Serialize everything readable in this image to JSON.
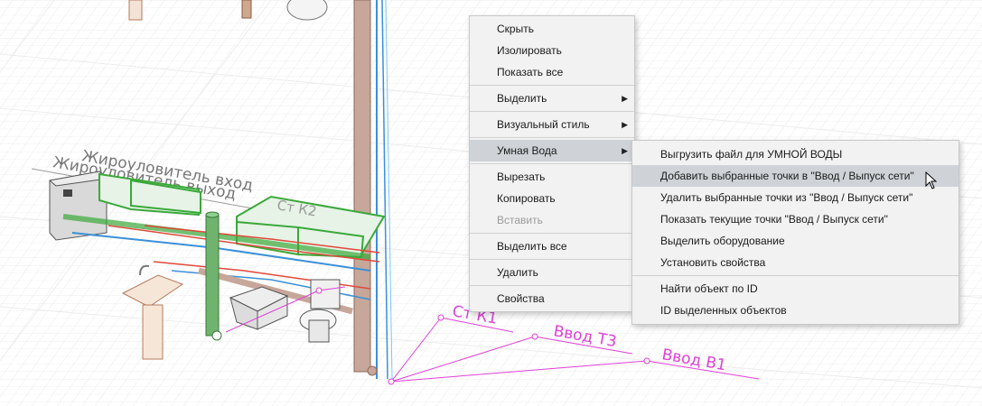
{
  "scene": {
    "labels": {
      "grease_trap_in": "Жироуловитель вход",
      "grease_trap_out": "Жироуловитель выход",
      "st_k2": "Ст К2",
      "st_k1": "Ст К1",
      "input_t3": "Ввод Т3",
      "input_v1": "Ввод В1"
    },
    "colors": {
      "annotation": "#e040d8",
      "pipe_green": "#3aa83a",
      "pipe_red": "#e0483a",
      "pipe_blue": "#3a90d8",
      "pipe_brown": "#a88070",
      "selection_green": "#4cc84c"
    }
  },
  "context_menu": {
    "items": [
      {
        "label": "Скрыть"
      },
      {
        "label": "Изолировать"
      },
      {
        "label": "Показать все"
      },
      {
        "label": "Выделить"
      },
      {
        "label": "Визуальный стиль"
      },
      {
        "label": "Умная Вода"
      },
      {
        "label": "Вырезать"
      },
      {
        "label": "Копировать"
      },
      {
        "label": "Вставить"
      },
      {
        "label": "Выделить все"
      },
      {
        "label": "Удалить"
      },
      {
        "label": "Свойства"
      }
    ]
  },
  "submenu": {
    "items": [
      {
        "label": "Выгрузить файл для УМНОЙ ВОДЫ"
      },
      {
        "label": "Добавить выбранные точки в \"Ввод / Выпуск сети\""
      },
      {
        "label": "Удалить выбранные точки из \"Ввод / Выпуск сети\""
      },
      {
        "label": "Показать текущие точки \"Ввод / Выпуск сети\""
      },
      {
        "label": "Выделить оборудование"
      },
      {
        "label": "Установить свойства"
      },
      {
        "label": "Найти объект по ID"
      },
      {
        "label": "ID выделенных объектов"
      }
    ]
  },
  "icons": {
    "submenu_arrow": "chevron-right-icon",
    "cursor": "mouse-pointer-icon"
  }
}
